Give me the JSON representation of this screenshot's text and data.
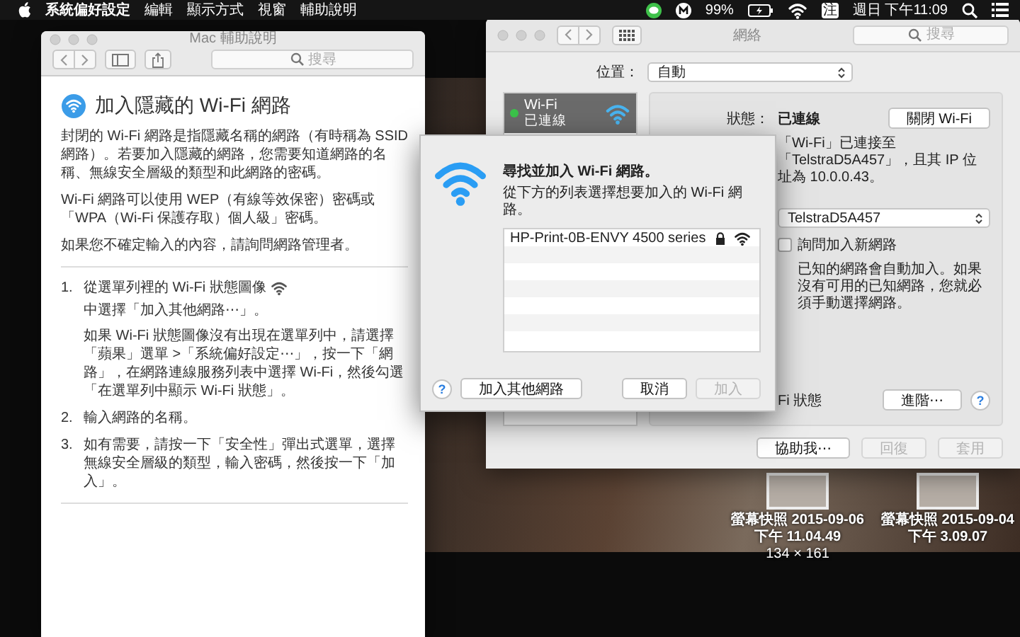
{
  "menu_bar": {
    "app": "系統偏好設定",
    "menus": [
      "編輯",
      "顯示方式",
      "視窗",
      "輔助說明"
    ],
    "battery": "99%",
    "input_method": "注",
    "clock": "週日 下午11:09"
  },
  "help_window": {
    "title": "Mac 輔助說明",
    "search": {
      "placeholder": "搜尋"
    },
    "heading": "加入隱藏的 Wi-Fi 網路",
    "paragraphs": [
      "封閉的 Wi-Fi 網路是指隱藏名稱的網路（有時稱為 SSID 網路）。若要加入隱藏的網路，您需要知道網路的名稱、無線安全層級的類型和此網路的密碼。",
      "Wi-Fi 網路可以使用 WEP（有線等效保密）密碼或「WPA（Wi-Fi 保護存取）個人級」密碼。",
      "如果您不確定輸入的內容，請詢問網路管理者。"
    ],
    "steps": [
      {
        "number": "1.",
        "text": "從選單列裡的 Wi-Fi 狀態圖像",
        "continuation": "中選擇「加入其他網路⋯」。",
        "note": "如果 Wi-Fi 狀態圖像沒有出現在選單列中，請選擇「蘋果」選單 >「系統偏好設定⋯」，按一下「網路」，在網路連線服務列表中選擇 Wi-Fi，然後勾選「在選單列中顯示 Wi-Fi 狀態」。"
      },
      {
        "number": "2.",
        "text": "輸入網路的名稱。"
      },
      {
        "number": "3.",
        "text": "如有需要，請按一下「安全性」彈出式選單，選擇無線安全層級的類型，輸入密碼，然後按一下「加入」。"
      }
    ]
  },
  "network_window": {
    "title": "網絡",
    "search": {
      "placeholder": "搜尋"
    },
    "location_label": "位置：",
    "location": "自動",
    "services": [
      {
        "name": "Wi-Fi",
        "status": "已連線",
        "selected": true
      }
    ],
    "status_label": "狀態：",
    "status": "已連線",
    "toggle_button": "關閉 Wi-Fi",
    "description": "「Wi-Fi」已連接至「TelstraD5A457」，且其 IP 位址為 10.0.0.43。",
    "network_name": "TelstraD5A457",
    "ask_to_join": {
      "label": "詢問加入新網路",
      "checked": false
    },
    "ask_hint": "已知的網路會自動加入。如果沒有可用的已知網路，您就必須手動選擇網路。",
    "menu_bar_option": "Fi 狀態",
    "advanced_button": "進階⋯",
    "help_button": "?",
    "footer_buttons": [
      {
        "label": "協助我⋯",
        "disabled": false
      },
      {
        "label": "回復",
        "disabled": true
      },
      {
        "label": "套用",
        "disabled": true
      }
    ]
  },
  "join_dialog": {
    "title": "尋找並加入 Wi-Fi 網路。",
    "subtitle": "從下方的列表選擇想要加入的 Wi-Fi 網路。",
    "networks": [
      {
        "name": "HP-Print-0B-ENVY 4500 series"
      }
    ],
    "help_button": "?",
    "buttons": [
      {
        "label": "加入其他網路",
        "disabled": false
      },
      {
        "label": "取消",
        "disabled": false
      },
      {
        "label": "加入",
        "disabled": true
      }
    ]
  },
  "desktop_items": [
    {
      "name": "螢幕快照 2015-09-06 下午 11.04.49",
      "size": "134 × 161"
    },
    {
      "name": "螢幕快照 2015-09-04 下午 3.09.07"
    }
  ]
}
